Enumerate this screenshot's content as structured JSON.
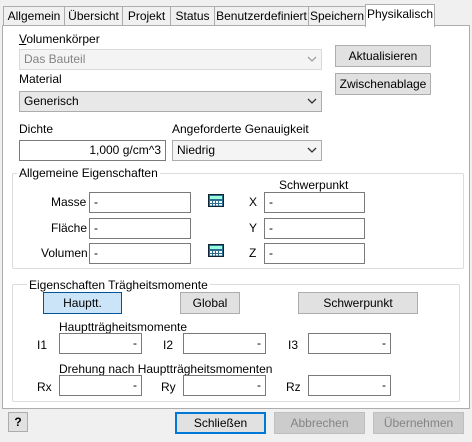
{
  "tabs": [
    {
      "label": "Allgemein",
      "active": false
    },
    {
      "label": "Übersicht",
      "active": false
    },
    {
      "label": "Projekt",
      "active": false
    },
    {
      "label": "Status",
      "active": false
    },
    {
      "label": "Benutzerdefiniert",
      "active": false
    },
    {
      "label": "Speichern",
      "active": false
    },
    {
      "label": "Physikalisch",
      "active": true
    }
  ],
  "volumenkoerper": {
    "label": "Volumenkörper",
    "value": "Das Bauteil"
  },
  "material": {
    "label": "Material",
    "value": "Generisch"
  },
  "dichte": {
    "label": "Dichte",
    "value": "1,000 g/cm^3"
  },
  "genauigkeit": {
    "label": "Angeforderte Genauigkeit",
    "value": "Niedrig"
  },
  "buttons": {
    "aktualisieren": "Aktualisieren",
    "zwischenablage": "Zwischenablage"
  },
  "allgemein": {
    "title": "Allgemeine Eigenschaften",
    "schwerpunkt_title": "Schwerpunkt",
    "masse_label": "Masse",
    "masse_value": "-",
    "flaeche_label": "Fläche",
    "flaeche_value": "-",
    "volumen_label": "Volumen",
    "volumen_value": "-",
    "x_label": "X",
    "x_value": "-",
    "y_label": "Y",
    "y_value": "-",
    "z_label": "Z",
    "z_value": "-"
  },
  "traegheit": {
    "title": "Eigenschaften Trägheitsmomente",
    "btn_hauptt": "Hauptt.",
    "btn_global": "Global",
    "btn_schwerpunkt": "Schwerpunkt",
    "haupt_title": "Hauptträgheitsmomente",
    "i1_label": "I1",
    "i1_value": "-",
    "i2_label": "I2",
    "i2_value": "-",
    "i3_label": "I3",
    "i3_value": "-",
    "drehung_title": "Drehung nach Hauptträgheitsmomenten",
    "rx_label": "Rx",
    "rx_value": "-",
    "ry_label": "Ry",
    "ry_value": "-",
    "rz_label": "Rz",
    "rz_value": "-"
  },
  "footer": {
    "help": "?",
    "schliessen": "Schließen",
    "abbrechen": "Abbrechen",
    "uebernehmen": "Übernehmen"
  }
}
